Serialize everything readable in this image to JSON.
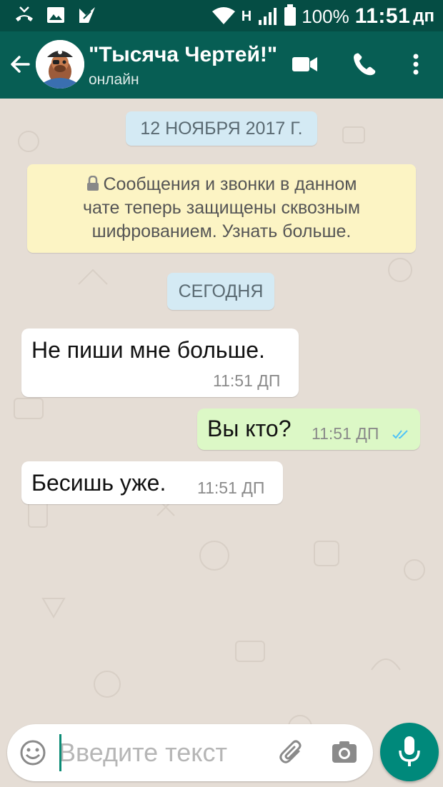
{
  "status_bar": {
    "network_label": "H",
    "battery": "100%",
    "time": "11:51",
    "ampm": "дп"
  },
  "header": {
    "contact_name": "\"Тысяча Чертей!\"",
    "status": "онлайн",
    "icons": [
      "back-arrow-icon",
      "video-call-icon",
      "phone-icon",
      "more-vert-icon"
    ]
  },
  "chat": {
    "date_chip": "12 НОЯБРЯ 2017 Г.",
    "encryption_notice": {
      "lines": [
        "Сообщения и звонки в данном",
        "чате теперь защищены сквозным",
        "шифрованием. Узнать больше."
      ]
    },
    "today_chip": "СЕГОДНЯ",
    "messages": [
      {
        "direction": "incoming",
        "text": "Не пиши мне больше.",
        "time": "11:51 ДП"
      },
      {
        "direction": "outgoing",
        "text": "Вы кто?",
        "time": "11:51 ДП",
        "status": "read"
      },
      {
        "direction": "incoming",
        "text": "Бесишь уже.",
        "time": "11:51 ДП"
      }
    ]
  },
  "input": {
    "placeholder": "Введите текст",
    "value": ""
  },
  "colors": {
    "header": "#075e54",
    "status_bar": "#054d44",
    "chat_bg": "#e5ddd5",
    "incoming": "#ffffff",
    "outgoing": "#dcf8c6",
    "accent": "#00897b",
    "read_ticks": "#4fc3f7"
  }
}
